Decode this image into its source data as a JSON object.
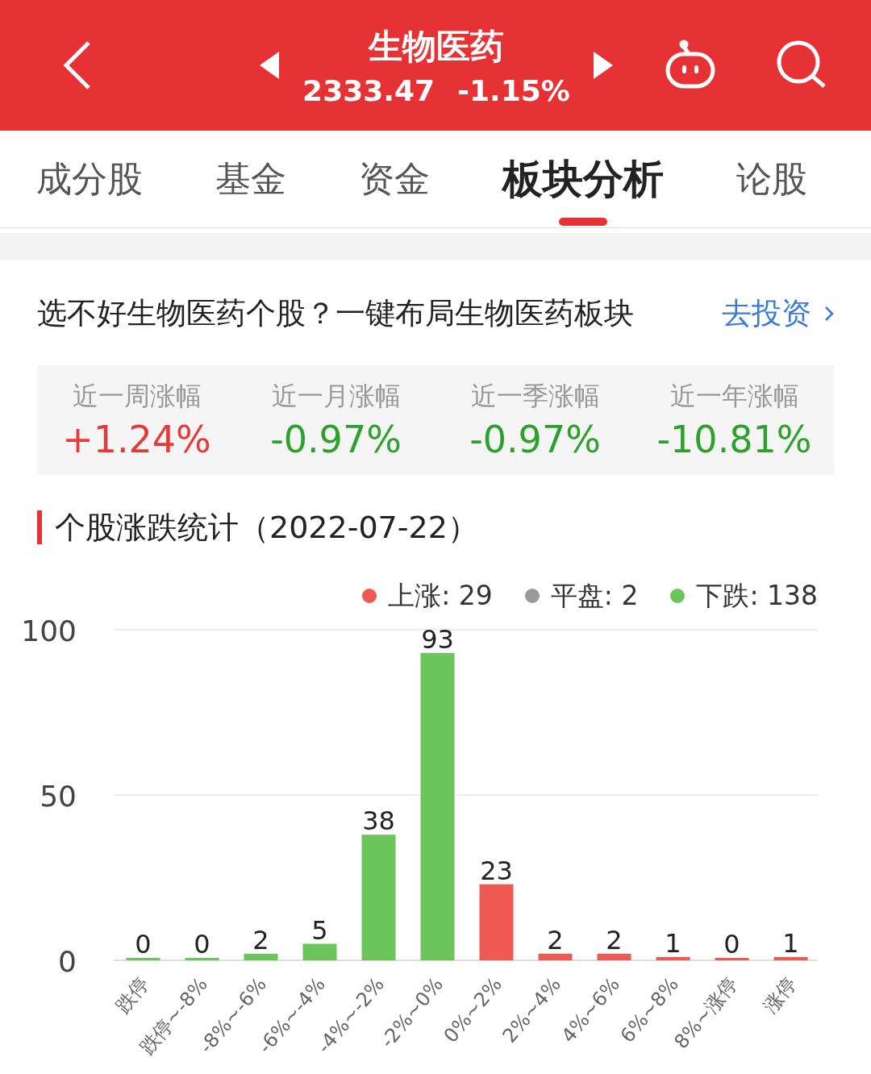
{
  "header": {
    "title": "生物医药",
    "price": "2333.47",
    "change": "-1.15%"
  },
  "tabs": [
    {
      "label": "成分股",
      "selected": false
    },
    {
      "label": "基金",
      "selected": false
    },
    {
      "label": "资金",
      "selected": false
    },
    {
      "label": "板块分析",
      "selected": true
    },
    {
      "label": "论股",
      "selected": false
    }
  ],
  "promo": {
    "text": "选不好生物医药个股？一键布局生物医药板块",
    "link": "去投资"
  },
  "stats": [
    {
      "label": "近一周涨幅",
      "value": "+1.24%",
      "color": "#e8393a"
    },
    {
      "label": "近一月涨幅",
      "value": "-0.97%",
      "color": "#2ca12c"
    },
    {
      "label": "近一季涨幅",
      "value": "-0.97%",
      "color": "#2ca12c"
    },
    {
      "label": "近一年涨幅",
      "value": "-10.81%",
      "color": "#2ca12c"
    }
  ],
  "section_title": "个股涨跌统计（2022-07-22）",
  "legend": [
    {
      "label": "上涨: 29",
      "color": "#ee5a52"
    },
    {
      "label": "平盘: 2",
      "color": "#999999"
    },
    {
      "label": "下跌: 138",
      "color": "#6cc55a"
    }
  ],
  "chart_data": {
    "type": "bar",
    "categories": [
      "跌停",
      "跌停~-8%",
      "-8%~-6%",
      "-6%~-4%",
      "-4%~-2%",
      "-2%~0%",
      "0%~2%",
      "2%~4%",
      "4%~6%",
      "6%~8%",
      "8%~涨停",
      "涨停"
    ],
    "series": [
      {
        "color": "#6cc55a",
        "values": [
          0,
          0,
          2,
          5,
          38,
          93,
          null,
          null,
          null,
          null,
          null,
          null
        ]
      },
      {
        "color": "#ee5a52",
        "values": [
          null,
          null,
          null,
          null,
          null,
          null,
          23,
          2,
          2,
          1,
          0,
          1
        ]
      }
    ],
    "stacked": true,
    "ylim": [
      0,
      100
    ],
    "yticks": [
      0,
      50,
      100
    ],
    "data_labels": true
  }
}
